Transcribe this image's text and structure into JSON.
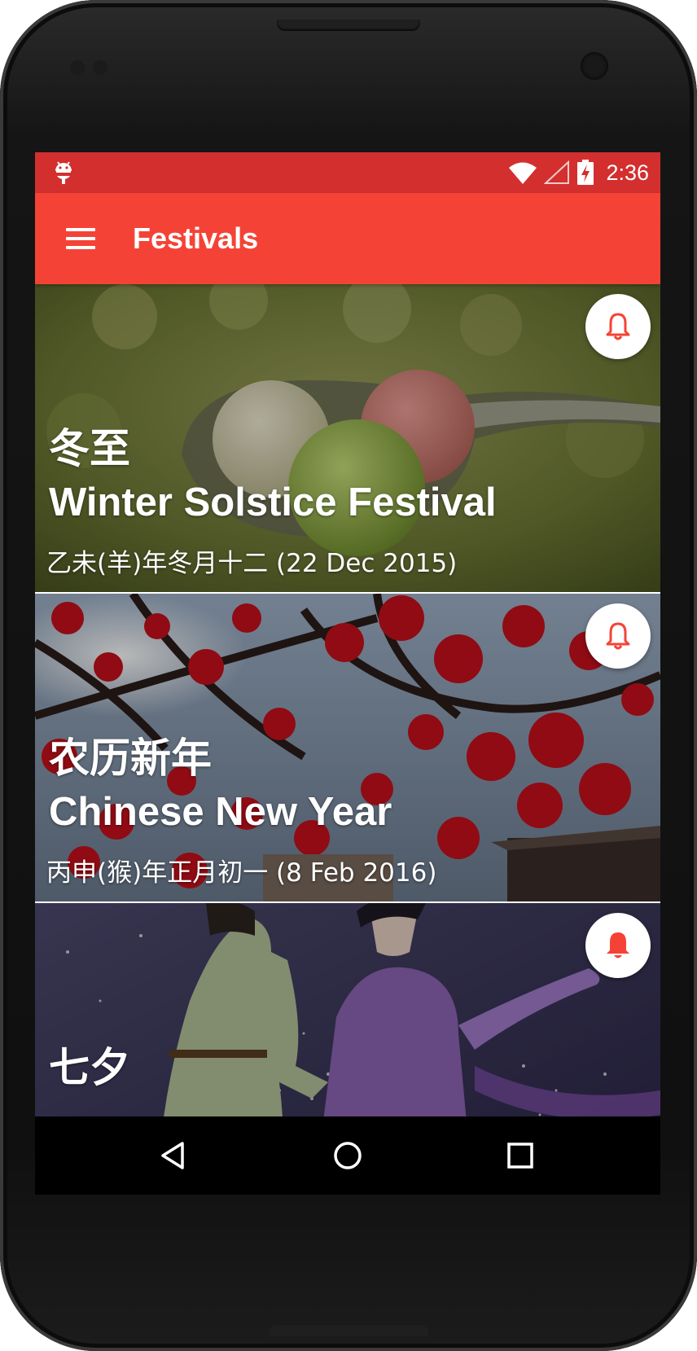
{
  "status_bar": {
    "time": "2:36",
    "left_icon": "android-debug-icon",
    "wifi_icon": "wifi-icon",
    "signal_icon": "signal-icon",
    "battery_icon": "battery-charging-icon"
  },
  "app_bar": {
    "title": "Festivals",
    "menu_icon": "hamburger-menu-icon",
    "background": "#f44336",
    "status_background": "#d32f2f"
  },
  "festivals": [
    {
      "chinese_name": "冬至",
      "english_name": "Winter Solstice Festival",
      "date": "乙未(羊)年冬月十二 (22 Dec 2015)",
      "reminder_icon": "bell-outline-icon",
      "reminder_set": false
    },
    {
      "chinese_name": "农历新年",
      "english_name": "Chinese New Year",
      "date": "丙申(猴)年正月初一 (8 Feb 2016)",
      "reminder_icon": "bell-outline-icon",
      "reminder_set": false
    },
    {
      "chinese_name": "七夕",
      "reminder_icon": "bell-filled-icon",
      "reminder_set": true
    }
  ],
  "nav_bar": {
    "back_icon": "back-triangle-icon",
    "home_icon": "home-circle-icon",
    "recents_icon": "recents-square-icon"
  },
  "colors": {
    "accent": "#f44336",
    "bell": "#f44336"
  }
}
